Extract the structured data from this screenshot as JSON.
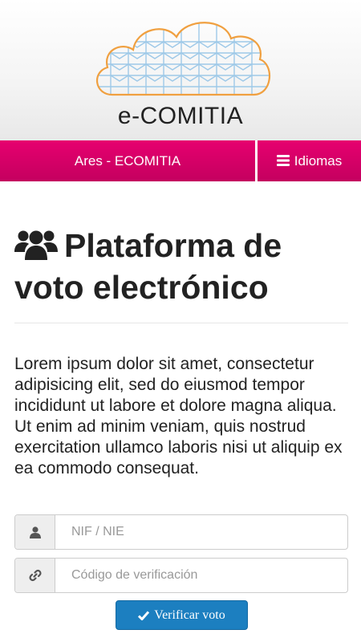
{
  "header": {
    "logo_text": "e-COMITIA"
  },
  "navbar": {
    "brand": "Ares - ECOMITIA",
    "languages_label": "Idiomas",
    "languages_icon": "bars-icon"
  },
  "main": {
    "title": "Plataforma de voto electrónico",
    "title_icon": "users-icon",
    "lead": "Lorem ipsum dolor sit amet, consectetur adipisicing elit, sed do eiusmod tempor incididunt ut labore et dolore magna aliqua. Ut enim ad minim veniam, quis nostrud exercitation ullamco laboris nisi ut aliquip ex ea commodo consequat."
  },
  "form": {
    "nif": {
      "value": "",
      "placeholder": "NIF / NIE",
      "icon": "user-icon"
    },
    "code": {
      "value": "",
      "placeholder": "Código de verificación",
      "icon": "link-icon"
    },
    "submit_label": "Verificar voto",
    "submit_icon": "check-icon"
  },
  "colors": {
    "navbar": "#e6006f",
    "button": "#1c7fc0",
    "logo_cloud": "#f0a040",
    "logo_grid": "#9ec9e8"
  }
}
